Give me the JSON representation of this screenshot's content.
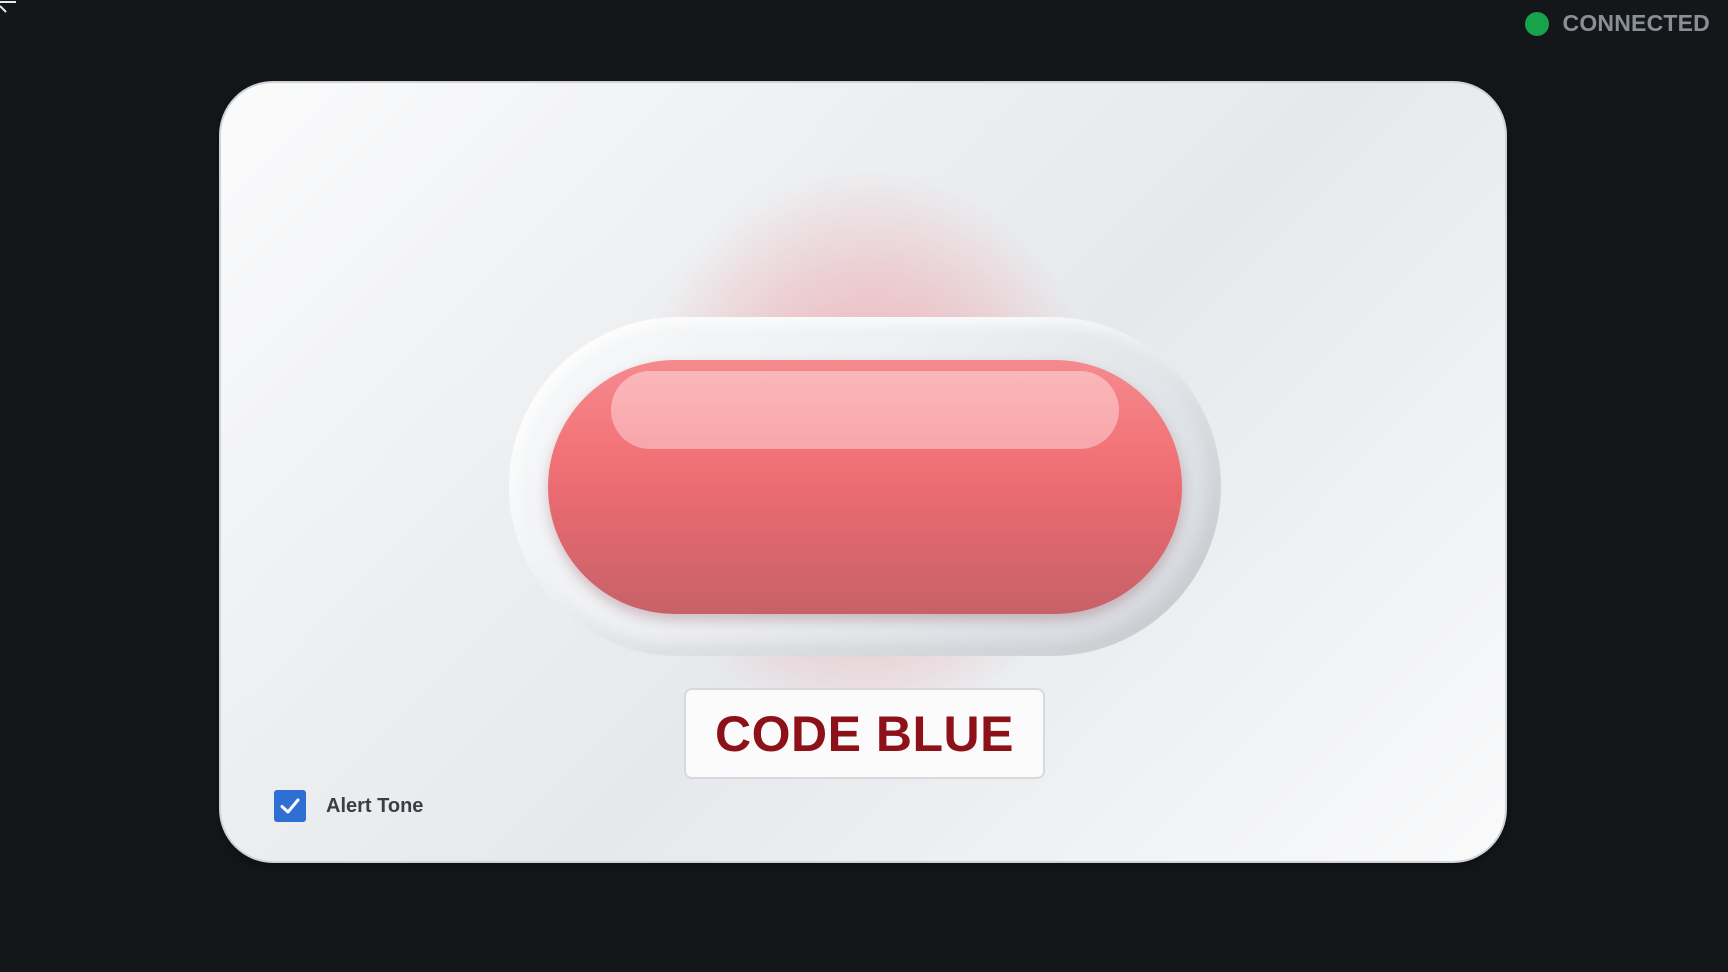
{
  "header": {
    "menu_icon": "menu-icon",
    "status": {
      "label": "CONNECTED",
      "color": "#17a34a"
    }
  },
  "panel": {
    "alarm_button": {
      "color": "#f27478"
    },
    "code_label": "CODE BLUE",
    "code_label_color": "#8c1119",
    "alert_tone": {
      "label": "Alert Tone",
      "checked": true,
      "icon": "checkmark-icon",
      "accent": "#2f6fd4"
    }
  }
}
